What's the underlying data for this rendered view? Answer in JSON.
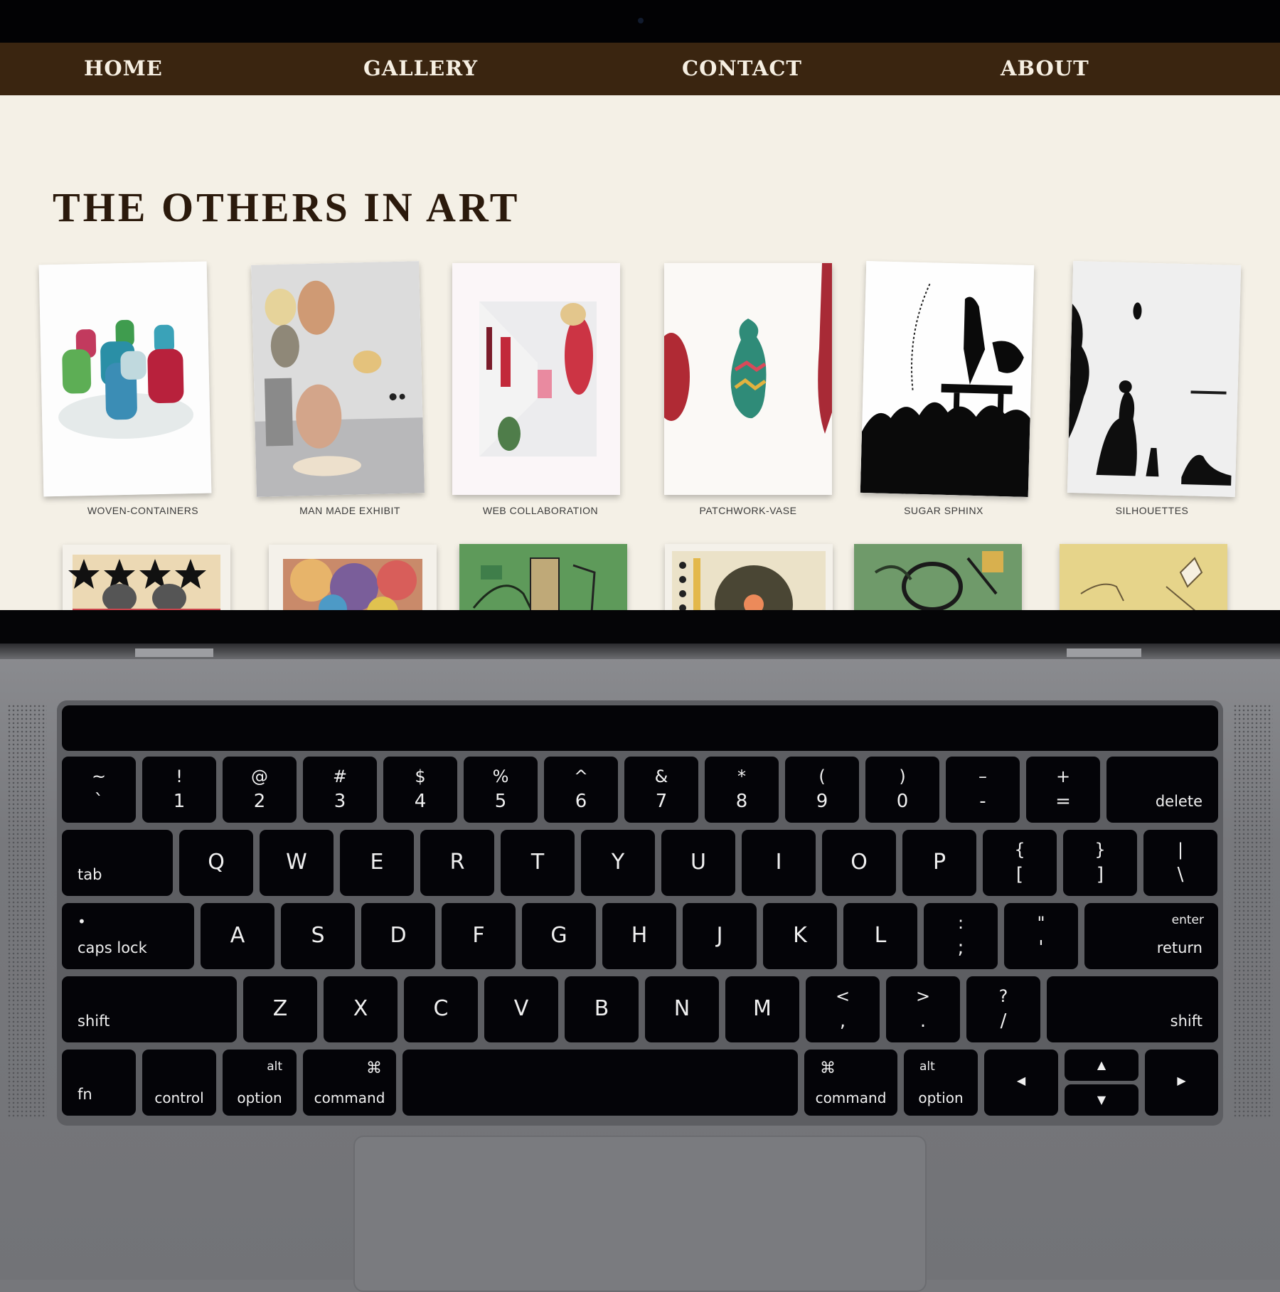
{
  "nav": {
    "home": "HOME",
    "gallery": "GALLERY",
    "contact": "CONTACT",
    "about": "ABOUT"
  },
  "page": {
    "title": "THE OTHERS IN ART"
  },
  "gallery": {
    "row1": [
      {
        "caption": "WOVEN-CONTAINERS",
        "image": "woven-containers-image"
      },
      {
        "caption": "MAN MADE EXHIBIT",
        "image": "lantern-exhibit-image"
      },
      {
        "caption": "WEB COLLABORATION",
        "image": "gallery-hall-image"
      },
      {
        "caption": "PATCHWORK-VASE",
        "image": "patchwork-vase-image"
      },
      {
        "caption": "SUGAR SPHINX",
        "image": "silhouette-crowd-image"
      },
      {
        "caption": "SILHOUETTES",
        "image": "silhouette-couple-image"
      }
    ],
    "row2": [
      {
        "image": "star-pattern-image"
      },
      {
        "image": "colorful-abstract-image"
      },
      {
        "image": "green-cubist-image"
      },
      {
        "image": "flower-circle-image"
      },
      {
        "image": "green-sketch-image"
      },
      {
        "image": "yellow-sketch-image"
      }
    ]
  },
  "keyboard": {
    "row1": [
      {
        "top": "~",
        "bottom": "`"
      },
      {
        "top": "!",
        "bottom": "1"
      },
      {
        "top": "@",
        "bottom": "2"
      },
      {
        "top": "#",
        "bottom": "3"
      },
      {
        "top": "$",
        "bottom": "4"
      },
      {
        "top": "%",
        "bottom": "5"
      },
      {
        "top": "^",
        "bottom": "6"
      },
      {
        "top": "&",
        "bottom": "7"
      },
      {
        "top": "*",
        "bottom": "8"
      },
      {
        "top": "(",
        "bottom": "9"
      },
      {
        "top": ")",
        "bottom": "0"
      },
      {
        "top": "–",
        "bottom": "-"
      },
      {
        "top": "+",
        "bottom": "="
      }
    ],
    "delete": "delete",
    "tab": "tab",
    "row2": [
      "Q",
      "W",
      "E",
      "R",
      "T",
      "Y",
      "U",
      "I",
      "O",
      "P"
    ],
    "row2_sym": [
      {
        "top": "{",
        "bottom": "["
      },
      {
        "top": "}",
        "bottom": "]"
      },
      {
        "top": "|",
        "bottom": "\\"
      }
    ],
    "caps_lock": "caps lock",
    "caps_dot": "•",
    "row3": [
      "A",
      "S",
      "D",
      "F",
      "G",
      "H",
      "J",
      "K",
      "L"
    ],
    "row3_sym": [
      {
        "top": ":",
        "bottom": ";"
      },
      {
        "top": "\"",
        "bottom": "'"
      }
    ],
    "enter": "enter",
    "return": "return",
    "shift": "shift",
    "row4": [
      "Z",
      "X",
      "C",
      "V",
      "B",
      "N",
      "M"
    ],
    "row4_sym": [
      {
        "top": "<",
        "bottom": ","
      },
      {
        "top": ">",
        "bottom": "."
      },
      {
        "top": "?",
        "bottom": "/"
      }
    ],
    "fn": "fn",
    "control": "control",
    "alt": "alt",
    "option": "option",
    "cmd_symbol": "⌘",
    "command": "command",
    "arrow_left": "◀",
    "arrow_up": "▲",
    "arrow_down": "▼",
    "arrow_right": "▶"
  }
}
